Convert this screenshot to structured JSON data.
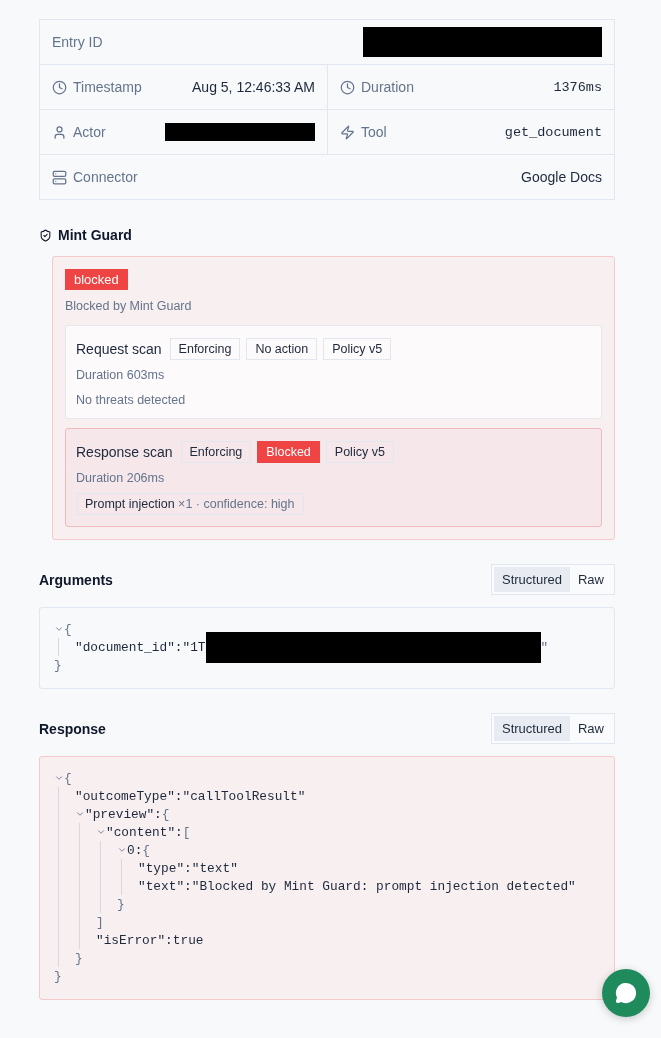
{
  "details": {
    "rows": [
      {
        "cells": [
          {
            "kind": "id",
            "label": "Entry ID",
            "value": {
              "kind": "redacted"
            }
          }
        ]
      },
      {
        "cells": [
          {
            "kind": "time",
            "label": "Timestamp",
            "value": {
              "kind": "text",
              "text": "Aug 5, 12:46:33 AM"
            }
          },
          {
            "kind": "duration",
            "label": "Duration",
            "value": {
              "kind": "mono",
              "text": "1376ms"
            }
          }
        ]
      },
      {
        "cells": [
          {
            "kind": "actor",
            "label": "Actor",
            "value": {
              "kind": "redacted"
            }
          },
          {
            "kind": "tool",
            "label": "Tool",
            "value": {
              "kind": "mono",
              "text": "get_document"
            }
          }
        ]
      },
      {
        "cells": [
          {
            "kind": "connector",
            "label": "Connector",
            "value": {
              "kind": "text",
              "text": "Google Docs"
            }
          }
        ]
      }
    ]
  },
  "guard": {
    "title": "Mint Guard",
    "status": "blocked",
    "summary": "Blocked by Mint Guard",
    "scans": [
      {
        "title": "Request scan",
        "blocked": false,
        "tags": [
          {
            "label": "Enforcing",
            "kind": "plain"
          },
          {
            "label": "No action",
            "kind": "plain"
          },
          {
            "label": "Policy v5",
            "kind": "plain"
          }
        ],
        "duration": "Duration 603ms",
        "note": "No threats detected"
      },
      {
        "title": "Response scan",
        "blocked": true,
        "tags": [
          {
            "label": "Enforcing",
            "kind": "plain"
          },
          {
            "label": "Blocked",
            "kind": "danger"
          },
          {
            "label": "Policy v5",
            "kind": "plain"
          }
        ],
        "duration": "Duration 206ms",
        "finding": {
          "name": "Prompt injection",
          "detail": "×1 · confidence: high"
        }
      }
    ]
  },
  "arguments": {
    "title": "Arguments",
    "error": false,
    "views": [
      {
        "label": "Structured",
        "selected": true
      },
      {
        "label": "Raw",
        "selected": false
      }
    ],
    "tree": {
      "open": "{",
      "close": "}",
      "expanded": true,
      "children": [
        {
          "key": "\"document_id\":",
          "value": "\"1T",
          "redacted": true,
          "value_tail": "\""
        }
      ]
    }
  },
  "response": {
    "title": "Response",
    "error": true,
    "views": [
      {
        "label": "Structured",
        "selected": true
      },
      {
        "label": "Raw",
        "selected": false
      }
    ],
    "tree": {
      "open": "{",
      "close": "}",
      "expanded": true,
      "children": [
        {
          "key": "\"outcomeType\":",
          "value": "\"callToolResult\""
        },
        {
          "key": "\"preview\":",
          "open": "{",
          "close": "}",
          "expanded": true,
          "children": [
            {
              "key": "\"content\":",
              "open": "[",
              "close": "]",
              "expanded": true,
              "children": [
                {
                  "key": "0:",
                  "open": "{",
                  "close": "}",
                  "expanded": true,
                  "children": [
                    {
                      "key": "\"type\":",
                      "value": "\"text\""
                    },
                    {
                      "key": "\"text\":",
                      "value": "\"Blocked by Mint Guard: prompt injection detected\""
                    }
                  ]
                }
              ]
            },
            {
              "key": "\"isError\":",
              "value": "true"
            }
          ]
        }
      ]
    }
  }
}
